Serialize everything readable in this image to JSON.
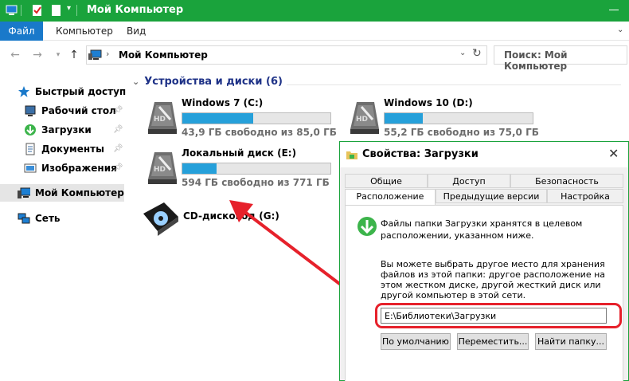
{
  "window": {
    "title": "Мой Компьютер"
  },
  "ribbon": {
    "tabs": [
      "Файл",
      "Компьютер",
      "Вид"
    ]
  },
  "address": {
    "path": "Мой Компьютер",
    "search_placeholder": "Поиск: Мой Компьютер"
  },
  "sidebar": {
    "items": [
      {
        "label": "Быстрый доступ",
        "icon": "star-icon"
      },
      {
        "label": "Рабочий стол",
        "icon": "desktop-icon",
        "pinned": true
      },
      {
        "label": "Загрузки",
        "icon": "downloads-icon",
        "pinned": true
      },
      {
        "label": "Документы",
        "icon": "documents-icon",
        "pinned": true
      },
      {
        "label": "Изображения",
        "icon": "pictures-icon",
        "pinned": true
      },
      {
        "label": "Мой Компьютер",
        "icon": "computer-icon",
        "selected": true
      },
      {
        "label": "Сеть",
        "icon": "network-icon"
      }
    ]
  },
  "devices": {
    "heading": "Устройства и диски (6)",
    "drives": [
      {
        "name": "Windows 7 (C:)",
        "free": "43,9 ГБ свободно из 85,0 ГБ",
        "used_fraction": 0.48
      },
      {
        "name": "Windows 10 (D:)",
        "free": "55,2 ГБ свободно из 75,0 ГБ",
        "used_fraction": 0.26
      },
      {
        "name": "Локальный диск (E:)",
        "free": "594 ГБ свободно из 771 ГБ",
        "used_fraction": 0.23
      },
      {
        "name": "CD-дисковод (G:)"
      }
    ]
  },
  "dialog": {
    "title": "Свойства: Загрузки",
    "tabs_row1": [
      "Общие",
      "Доступ",
      "Безопасность"
    ],
    "tabs_row2": [
      "Расположение",
      "Предыдущие версии",
      "Настройка"
    ],
    "info": "Файлы папки Загрузки хранятся в целевом расположении, указанном ниже.",
    "hint": "Вы можете выбрать другое место для хранения файлов из этой папки: другое расположение на этом жестком диске, другой жесткий диск или другой компьютер в этой сети.",
    "path_value": "E:\\Библиотеки\\Загрузки",
    "buttons": [
      "По умолчанию",
      "Переместить...",
      "Найти папку..."
    ]
  },
  "colors": {
    "accent": "#1aa33c",
    "file_tab": "#1979ca",
    "drive_bar": "#26a0da",
    "highlight": "#e6212b"
  }
}
